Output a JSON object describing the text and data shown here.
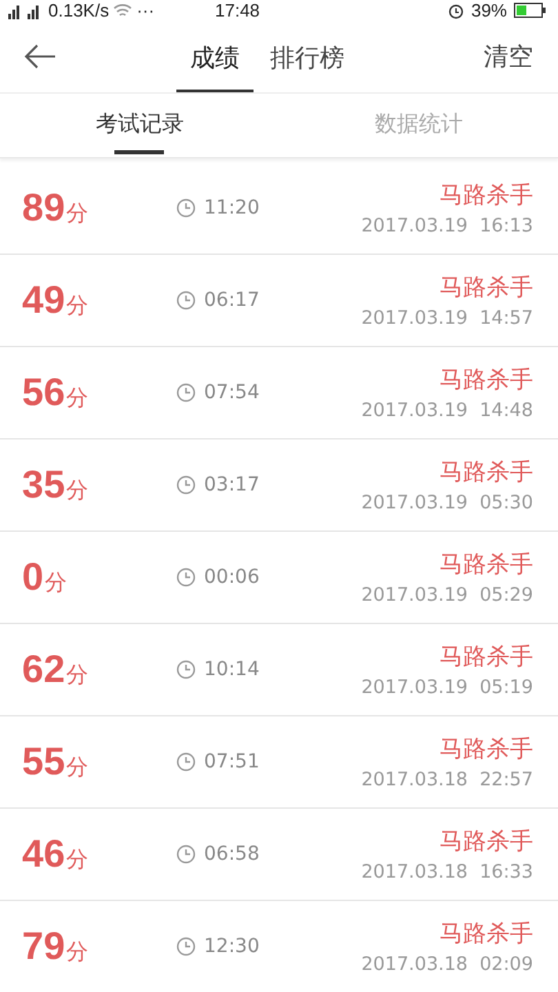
{
  "status_bar": {
    "speed": "0.13K/s",
    "more": "···",
    "time": "17:48",
    "battery": "39%"
  },
  "top_bar": {
    "tabs": [
      {
        "label": "成绩",
        "selected": true
      },
      {
        "label": "排行榜",
        "selected": false
      }
    ],
    "action": "清空"
  },
  "sub_tabs": [
    {
      "label": "考试记录",
      "selected": true
    },
    {
      "label": "数据统计",
      "selected": false
    }
  ],
  "records": [
    {
      "score": "89",
      "unit": "分",
      "duration": "11:20",
      "title": "马路杀手",
      "date": "2017.03.19  16:13"
    },
    {
      "score": "49",
      "unit": "分",
      "duration": "06:17",
      "title": "马路杀手",
      "date": "2017.03.19  14:57"
    },
    {
      "score": "56",
      "unit": "分",
      "duration": "07:54",
      "title": "马路杀手",
      "date": "2017.03.19  14:48"
    },
    {
      "score": "35",
      "unit": "分",
      "duration": "03:17",
      "title": "马路杀手",
      "date": "2017.03.19  05:30"
    },
    {
      "score": "0",
      "unit": "分",
      "duration": "00:06",
      "title": "马路杀手",
      "date": "2017.03.19  05:29"
    },
    {
      "score": "62",
      "unit": "分",
      "duration": "10:14",
      "title": "马路杀手",
      "date": "2017.03.19  05:19"
    },
    {
      "score": "55",
      "unit": "分",
      "duration": "07:51",
      "title": "马路杀手",
      "date": "2017.03.18  22:57"
    },
    {
      "score": "46",
      "unit": "分",
      "duration": "06:58",
      "title": "马路杀手",
      "date": "2017.03.18  16:33"
    },
    {
      "score": "79",
      "unit": "分",
      "duration": "12:30",
      "title": "马路杀手",
      "date": "2017.03.18  02:09"
    }
  ]
}
